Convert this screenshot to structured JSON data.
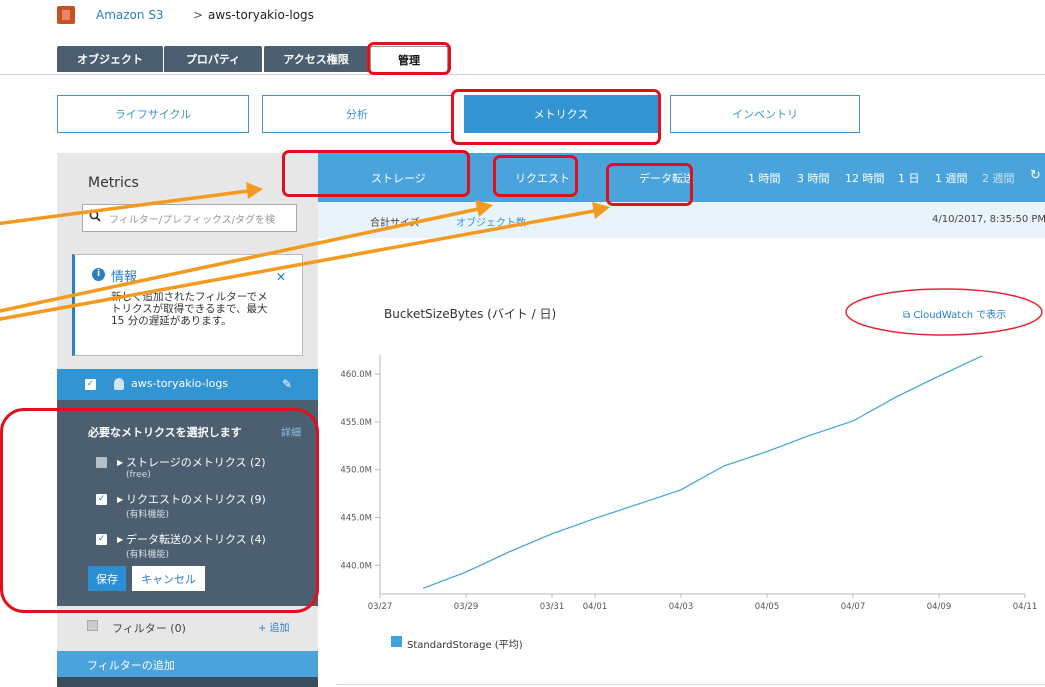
{
  "breadcrumb": {
    "root": "Amazon S3",
    "separator": ">",
    "bucket": "aws-toryakio-logs"
  },
  "main_tabs": [
    "オブジェクト",
    "プロパティ",
    "アクセス権限",
    "管理"
  ],
  "sub_tabs": [
    "ライフサイクル",
    "分析",
    "メトリクス",
    "インベントリ"
  ],
  "left": {
    "title": "Metrics",
    "filter_placeholder": "フィルター/プレフィックス/タグを検",
    "info_title": "情報",
    "info_text": "新しく追加されたフィルターでメトリクスが取得できるまで、最大 15 分の遅延があります。",
    "bucket_name": "aws-toryakio-logs",
    "select_title": "必要なメトリクスを選択します",
    "select_detail": "詳細",
    "options": [
      {
        "label": "ストレージのメトリクス (2)",
        "sub": "(free)",
        "checked": false
      },
      {
        "label": "リクエストのメトリクス (9)",
        "sub": "(有料機能)",
        "checked": true
      },
      {
        "label": "データ転送のメトリクス (4)",
        "sub": "(有料機能)",
        "checked": true
      }
    ],
    "save": "保存",
    "cancel": "キャンセル",
    "filter_label": "フィルター (0)",
    "add_link": "+ 追加",
    "add_filter_bar": "フィルターの追加"
  },
  "metric_tabs": [
    "ストレージ",
    "リクエスト",
    "データ転送"
  ],
  "time_ranges": [
    "1 時間",
    "3 時間",
    "12 時間",
    "1 日",
    "1 週間",
    "2 週間"
  ],
  "info_bar": {
    "sum_size": "合計サイズ",
    "object_count": "オブジェクト数",
    "timestamp": "4/10/2017, 8:35:50 PM"
  },
  "chart_title": "BucketSizeBytes (バイト / 日)",
  "cloudwatch_link": "CloudWatch で表示",
  "chart_data": {
    "type": "line",
    "title": "BucketSizeBytes (バイト / 日)",
    "x": [
      "03/28",
      "03/29",
      "03/30",
      "03/31",
      "04/01",
      "04/02",
      "04/03",
      "04/04",
      "04/05",
      "04/06",
      "04/07",
      "04/08",
      "04/09",
      "04/10"
    ],
    "x_ticks": [
      "03/27",
      "03/29",
      "03/31",
      "04/01",
      "04/03",
      "04/05",
      "04/07",
      "04/09",
      "04/11"
    ],
    "y_ticks": [
      "440.0M",
      "445.0M",
      "450.0M",
      "455.0M",
      "460.0M"
    ],
    "ylim": [
      437.0,
      462.0
    ],
    "series": [
      {
        "name": "StandardStorage (平均)",
        "color": "#3fa2d8",
        "values": [
          437.6,
          439.3,
          441.4,
          443.3,
          444.9,
          446.4,
          447.9,
          450.4,
          451.9,
          453.6,
          455.1,
          457.6,
          459.8,
          461.9
        ]
      }
    ],
    "legend": "bottom-left",
    "grid": false
  },
  "colors": {
    "accent": "#3294d2",
    "highlight": "#e0101e",
    "arrow": "#f39a1f"
  }
}
